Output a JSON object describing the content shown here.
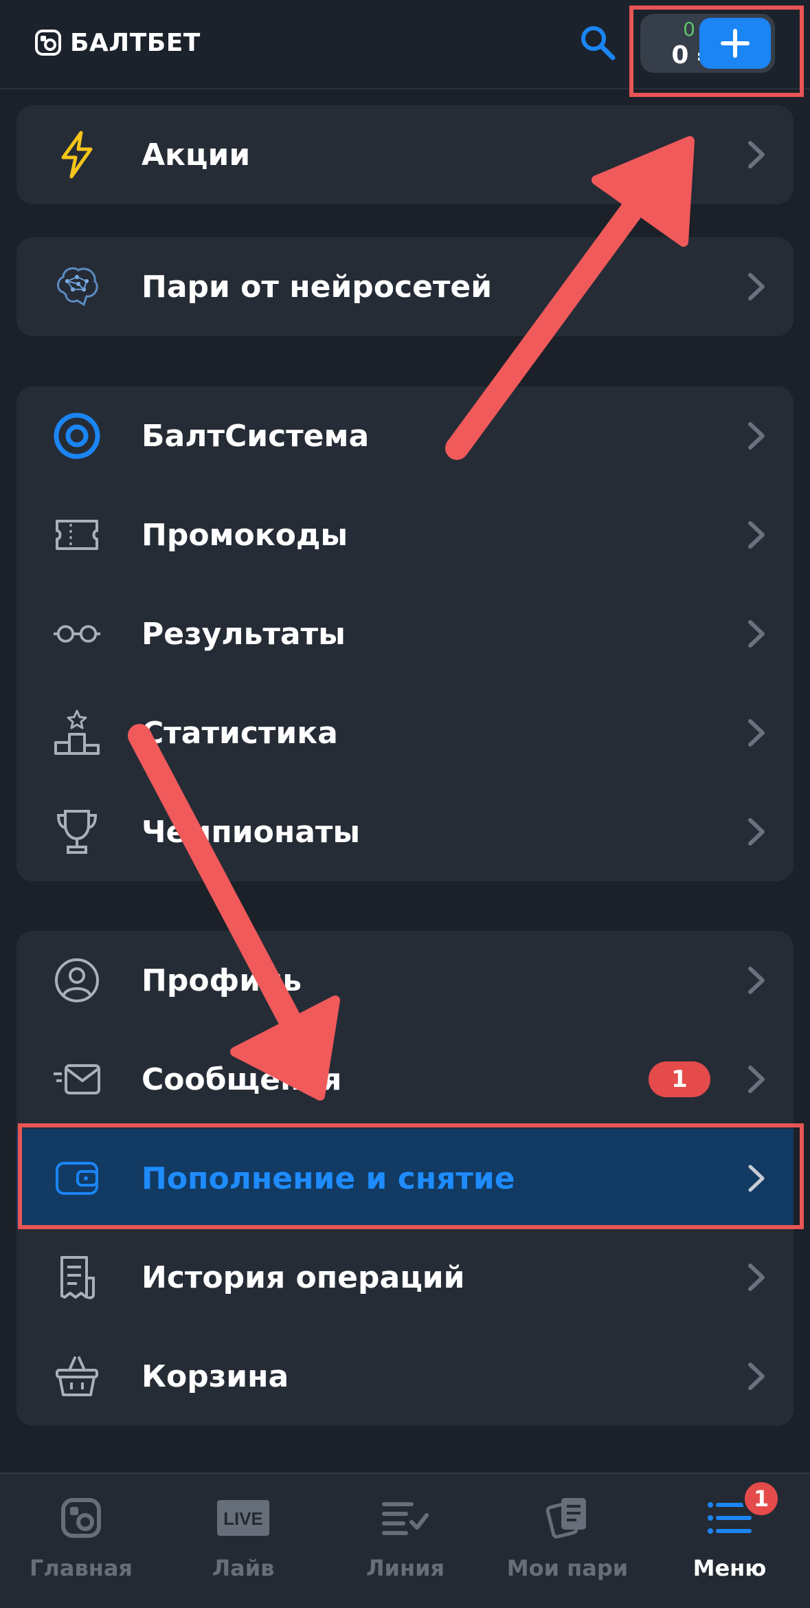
{
  "header": {
    "logo_text": "БАЛТБЕТ",
    "bonus_balance": "0 Б",
    "money_balance": "0 ₽"
  },
  "menu": {
    "promos": "Акции",
    "neural_bets": "Пари от нейросетей",
    "baltsystem": "БалтСистема",
    "promocodes": "Промокоды",
    "results": "Результаты",
    "statistics": "Статистика",
    "championships": "Чемпионаты",
    "profile": "Профиль",
    "messages": "Сообщения",
    "messages_badge": "1",
    "deposit_withdraw": "Пополнение и снятие",
    "history": "История операций",
    "cart": "Корзина"
  },
  "tabbar": {
    "home": "Главная",
    "live": "Лайв",
    "live_icon_text": "LIVE",
    "line": "Линия",
    "my_bets": "Мои пари",
    "menu": "Меню",
    "menu_badge": "1"
  },
  "colors": {
    "background": "#1b2029",
    "card": "#262c36",
    "accent_blue": "#1b85f4",
    "active_row": "#123a63",
    "bonus_green": "#5cc46a",
    "badge_red": "#e54b4b",
    "annotation_red": "#e85555",
    "lightning_yellow": "#f5c518"
  }
}
